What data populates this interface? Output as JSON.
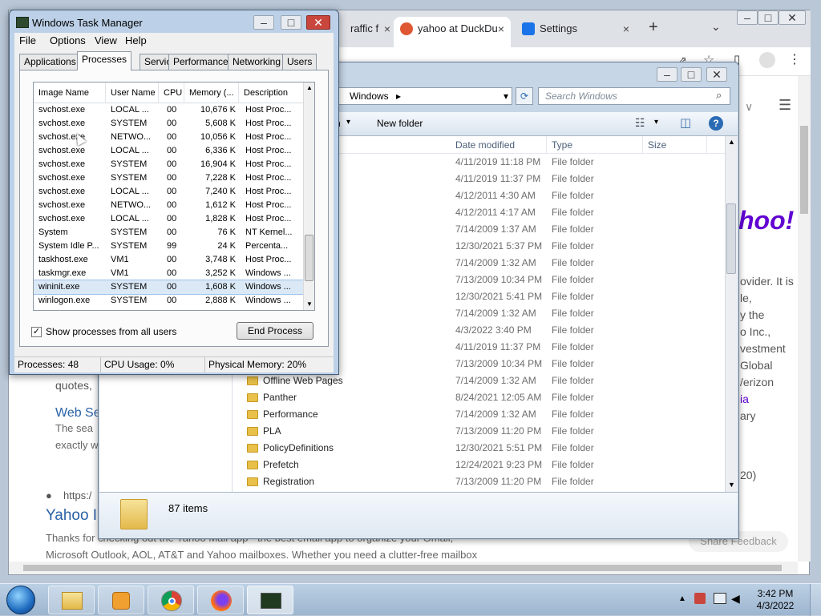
{
  "chrome": {
    "tabs": [
      {
        "label": "raffic f"
      },
      {
        "label": "yahoo at DuckDu"
      },
      {
        "label": "Settings"
      }
    ],
    "new_tab_glyph": "+",
    "page_lines": [
      "ovider. It is",
      "le,",
      "y the",
      "o Inc.,",
      "vestment",
      "Global",
      "/erizon",
      "ia",
      "ary"
    ],
    "left_snippets": {
      "quotes": "quotes,",
      "web_heading": "Web Se",
      "web_text_1": "The sea",
      "web_text_2": "exactly w",
      "url_prefix": "https:/",
      "result_title": "Yahoo I",
      "result_text_1": "Thanks for checking out the Yahoo Mail app - the best email app to organize your Gmail,",
      "result_text_2": "Microsoft Outlook, AOL, AT&T and Yahoo mailboxes. Whether you need a clutter-free mailbox",
      "share_feedback": "Share Feedback",
      "year_fragment": "20)"
    },
    "logo_text": "hoo!"
  },
  "explorer": {
    "address_path": "Windows",
    "search_placeholder": "Search Windows",
    "new_folder_label": "New folder",
    "cmd_fragment": "n",
    "columns": {
      "date": "Date modified",
      "type": "Type",
      "size": "Size"
    },
    "rows": [
      {
        "name": "",
        "date": "4/11/2019 11:18 PM",
        "type": "File folder"
      },
      {
        "name": "",
        "date": "4/11/2019 11:37 PM",
        "type": "File folder"
      },
      {
        "name": "",
        "date": "4/12/2011 4:30 AM",
        "type": "File folder"
      },
      {
        "name": "",
        "date": "4/12/2011 4:17 AM",
        "type": "File folder"
      },
      {
        "name": "",
        "date": "7/14/2009 1:37 AM",
        "type": "File folder"
      },
      {
        "name": "",
        "date": "12/30/2021 5:37 PM",
        "type": "File folder"
      },
      {
        "name": "",
        "date": "7/14/2009 1:32 AM",
        "type": "File folder"
      },
      {
        "name": "",
        "date": "7/13/2009 10:34 PM",
        "type": "File folder"
      },
      {
        "name": "",
        "date": "12/30/2021 5:41 PM",
        "type": "File folder"
      },
      {
        "name": "",
        "date": "7/14/2009 1:32 AM",
        "type": "File folder"
      },
      {
        "name": "",
        "date": "4/3/2022 3:40 PM",
        "type": "File folder"
      },
      {
        "name": "",
        "date": "4/11/2019 11:37 PM",
        "type": "File folder"
      },
      {
        "name": "",
        "date": "7/13/2009 10:34 PM",
        "type": "File folder"
      },
      {
        "name": "Offline Web Pages",
        "date": "7/14/2009 1:32 AM",
        "type": "File folder"
      },
      {
        "name": "Panther",
        "date": "8/24/2021 12:05 AM",
        "type": "File folder"
      },
      {
        "name": "Performance",
        "date": "7/14/2009 1:32 AM",
        "type": "File folder"
      },
      {
        "name": "PLA",
        "date": "7/13/2009 11:20 PM",
        "type": "File folder"
      },
      {
        "name": "PolicyDefinitions",
        "date": "12/30/2021 5:51 PM",
        "type": "File folder"
      },
      {
        "name": "Prefetch",
        "date": "12/24/2021 9:23 PM",
        "type": "File folder"
      },
      {
        "name": "Registration",
        "date": "7/13/2009 11:20 PM",
        "type": "File folder"
      }
    ],
    "item_count": "87 items"
  },
  "taskmgr": {
    "title": "Windows Task Manager",
    "menu": [
      "File",
      "Options",
      "View",
      "Help"
    ],
    "tabs": [
      "Applications",
      "Processes",
      "Services",
      "Performance",
      "Networking",
      "Users"
    ],
    "active_tab": "Processes",
    "columns": {
      "image": "Image Name",
      "user": "User Name",
      "cpu": "CPU",
      "mem": "Memory (...",
      "desc": "Description"
    },
    "processes": [
      {
        "image": "svchost.exe",
        "user": "LOCAL ...",
        "cpu": "00",
        "mem": "10,676 K",
        "desc": "Host Proc..."
      },
      {
        "image": "svchost.exe",
        "user": "SYSTEM",
        "cpu": "00",
        "mem": "5,608 K",
        "desc": "Host Proc..."
      },
      {
        "image": "svchost.exe",
        "user": "NETWO...",
        "cpu": "00",
        "mem": "10,056 K",
        "desc": "Host Proc..."
      },
      {
        "image": "svchost.exe",
        "user": "LOCAL ...",
        "cpu": "00",
        "mem": "6,336 K",
        "desc": "Host Proc..."
      },
      {
        "image": "svchost.exe",
        "user": "SYSTEM",
        "cpu": "00",
        "mem": "16,904 K",
        "desc": "Host Proc..."
      },
      {
        "image": "svchost.exe",
        "user": "SYSTEM",
        "cpu": "00",
        "mem": "7,228 K",
        "desc": "Host Proc..."
      },
      {
        "image": "svchost.exe",
        "user": "LOCAL ...",
        "cpu": "00",
        "mem": "7,240 K",
        "desc": "Host Proc..."
      },
      {
        "image": "svchost.exe",
        "user": "NETWO...",
        "cpu": "00",
        "mem": "1,612 K",
        "desc": "Host Proc..."
      },
      {
        "image": "svchost.exe",
        "user": "LOCAL ...",
        "cpu": "00",
        "mem": "1,828 K",
        "desc": "Host Proc..."
      },
      {
        "image": "System",
        "user": "SYSTEM",
        "cpu": "00",
        "mem": "76 K",
        "desc": "NT Kernel..."
      },
      {
        "image": "System Idle P...",
        "user": "SYSTEM",
        "cpu": "99",
        "mem": "24 K",
        "desc": "Percenta..."
      },
      {
        "image": "taskhost.exe",
        "user": "VM1",
        "cpu": "00",
        "mem": "3,748 K",
        "desc": "Host Proc..."
      },
      {
        "image": "taskmgr.exe",
        "user": "VM1",
        "cpu": "00",
        "mem": "3,252 K",
        "desc": "Windows ..."
      },
      {
        "image": "wininit.exe",
        "user": "SYSTEM",
        "cpu": "00",
        "mem": "1,608 K",
        "desc": "Windows ..."
      },
      {
        "image": "winlogon.exe",
        "user": "SYSTEM",
        "cpu": "00",
        "mem": "2,888 K",
        "desc": "Windows ..."
      }
    ],
    "selected_row": 13,
    "show_all_label": "Show processes from all users",
    "show_all_checked": true,
    "end_process_label": "End Process",
    "status": {
      "processes": "Processes: 48",
      "cpu": "CPU Usage: 0%",
      "memory": "Physical Memory: 20%"
    }
  },
  "taskbar": {
    "apps": [
      "start-orb",
      "windows-explorer",
      "media-player",
      "chrome",
      "firefox",
      "task-manager"
    ],
    "time": "3:42 PM",
    "date": "4/3/2022"
  }
}
